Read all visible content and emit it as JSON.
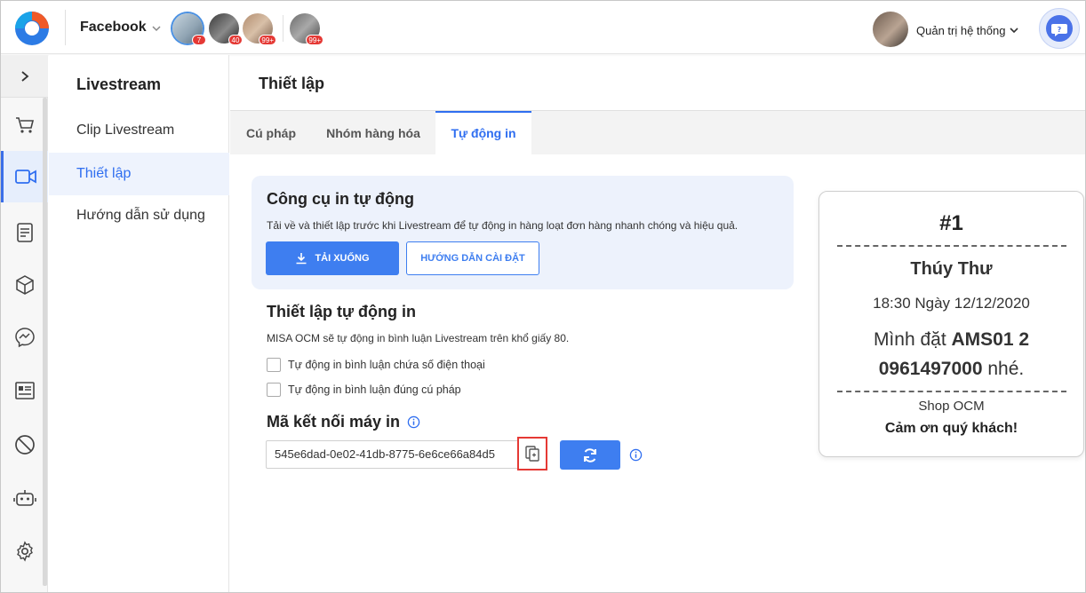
{
  "header": {
    "platform": "Facebook",
    "pages": [
      {
        "badge": "7"
      },
      {
        "badge": "40"
      },
      {
        "badge": "99+"
      },
      {
        "badge": "99+"
      }
    ],
    "user_name": "Quản trị hệ thống"
  },
  "rail": {
    "items": [
      "cart-icon",
      "video-icon",
      "document-icon",
      "box-icon",
      "messenger-icon",
      "contact-card-icon",
      "block-icon",
      "bot-icon",
      "settings-icon"
    ],
    "active": "video-icon"
  },
  "subnav": {
    "title": "Livestream",
    "items": [
      {
        "label": "Clip Livestream"
      },
      {
        "label": "Thiết lập"
      },
      {
        "label": "Hướng dẫn sử dụng"
      }
    ],
    "active_index": 1
  },
  "main": {
    "title": "Thiết lập",
    "tabs": [
      {
        "label": "Cú pháp"
      },
      {
        "label": "Nhóm hàng hóa"
      },
      {
        "label": "Tự động in"
      }
    ],
    "active_tab": 2,
    "tool": {
      "title": "Công cụ in tự động",
      "desc": "Tải về và thiết lập trước khi Livestream để tự động in hàng loạt đơn hàng nhanh chóng và hiệu quả.",
      "download_label": "TẢI XUỐNG",
      "guide_label": "HƯỚNG DẪN CÀI ĐẶT"
    },
    "auto_print": {
      "title": "Thiết lập tự động in",
      "desc": "MISA OCM sẽ tự động in bình luận Livestream trên khổ giấy 80.",
      "options": [
        {
          "label": "Tự động in bình luận chứa số điện thoại",
          "checked": false
        },
        {
          "label": "Tự động in bình luận đúng cú pháp",
          "checked": false
        }
      ]
    },
    "printer_code": {
      "title": "Mã kết nối máy in",
      "value": "545e6dad-0e02-41db-8775-6e6ce66a84d5"
    }
  },
  "receipt": {
    "number": "#1",
    "customer": "Thúy Thư",
    "time": "18:30 Ngày 12/12/2020",
    "msg_prefix": "Mình đặt ",
    "msg_code": "AMS01 2",
    "msg_phone": "0961497000",
    "msg_suffix": " nhé.",
    "shop": "Shop OCM",
    "thanks": "Cảm ơn quý khách!"
  },
  "colors": {
    "accent": "#3e7ef0",
    "badge": "#e53935",
    "card_bg": "#edf2fc",
    "active_nav_bg": "#eef3fd"
  }
}
